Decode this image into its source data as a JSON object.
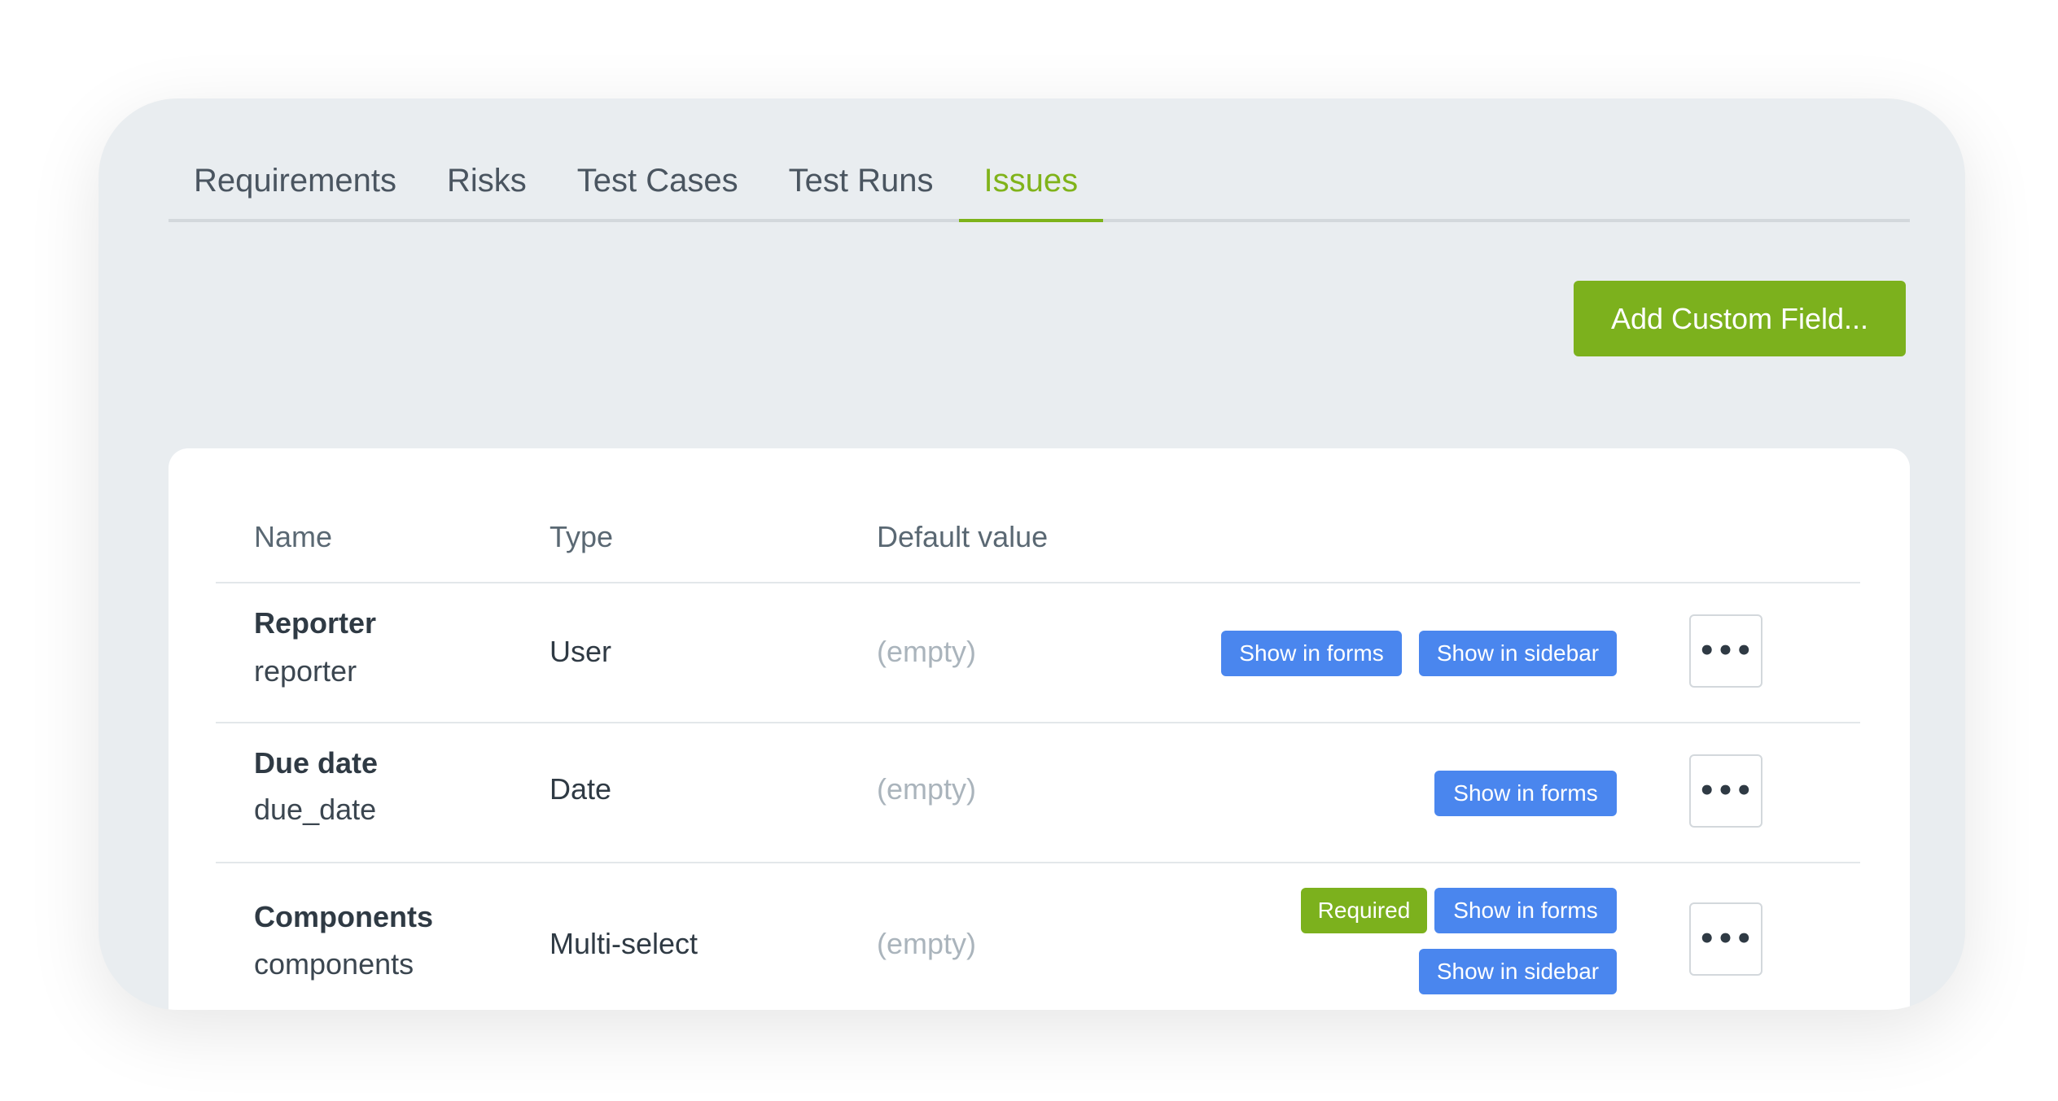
{
  "tabs": [
    {
      "label": "Requirements"
    },
    {
      "label": "Risks"
    },
    {
      "label": "Test Cases"
    },
    {
      "label": "Test Runs"
    },
    {
      "label": "Issues",
      "active": true
    }
  ],
  "toolbar": {
    "add_label": "Add Custom Field..."
  },
  "table": {
    "columns": {
      "name": "Name",
      "type": "Type",
      "default": "Default value"
    },
    "rows": [
      {
        "title": "Reporter",
        "key": "reporter",
        "type": "User",
        "default": "(empty)",
        "tags": [
          "Show in forms",
          "Show in sidebar"
        ],
        "more": "•••"
      },
      {
        "title": "Due date",
        "key": "due_date",
        "type": "Date",
        "default": "(empty)",
        "tags": [
          "Show in forms"
        ],
        "more": "•••"
      },
      {
        "title": "Components",
        "key": "components",
        "type": "Multi-select",
        "default": "(empty)",
        "tags": [
          "Required",
          "Show in forms",
          "Show in sidebar"
        ],
        "more": "•••"
      }
    ]
  },
  "colors": {
    "accent": "#7cb11d",
    "tag_blue": "#4a86ee",
    "card_bg": "#e9edf0"
  }
}
